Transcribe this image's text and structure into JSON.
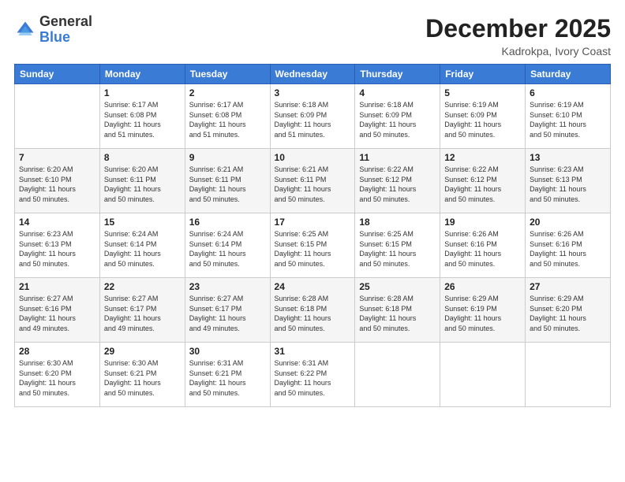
{
  "header": {
    "logo": {
      "general": "General",
      "blue": "Blue"
    },
    "month": "December 2025",
    "location": "Kadrokpa, Ivory Coast"
  },
  "weekdays": [
    "Sunday",
    "Monday",
    "Tuesday",
    "Wednesday",
    "Thursday",
    "Friday",
    "Saturday"
  ],
  "weeks": [
    [
      {
        "day": "",
        "info": ""
      },
      {
        "day": "1",
        "info": "Sunrise: 6:17 AM\nSunset: 6:08 PM\nDaylight: 11 hours\nand 51 minutes."
      },
      {
        "day": "2",
        "info": "Sunrise: 6:17 AM\nSunset: 6:08 PM\nDaylight: 11 hours\nand 51 minutes."
      },
      {
        "day": "3",
        "info": "Sunrise: 6:18 AM\nSunset: 6:09 PM\nDaylight: 11 hours\nand 51 minutes."
      },
      {
        "day": "4",
        "info": "Sunrise: 6:18 AM\nSunset: 6:09 PM\nDaylight: 11 hours\nand 50 minutes."
      },
      {
        "day": "5",
        "info": "Sunrise: 6:19 AM\nSunset: 6:09 PM\nDaylight: 11 hours\nand 50 minutes."
      },
      {
        "day": "6",
        "info": "Sunrise: 6:19 AM\nSunset: 6:10 PM\nDaylight: 11 hours\nand 50 minutes."
      }
    ],
    [
      {
        "day": "7",
        "info": "Sunrise: 6:20 AM\nSunset: 6:10 PM\nDaylight: 11 hours\nand 50 minutes."
      },
      {
        "day": "8",
        "info": "Sunrise: 6:20 AM\nSunset: 6:11 PM\nDaylight: 11 hours\nand 50 minutes."
      },
      {
        "day": "9",
        "info": "Sunrise: 6:21 AM\nSunset: 6:11 PM\nDaylight: 11 hours\nand 50 minutes."
      },
      {
        "day": "10",
        "info": "Sunrise: 6:21 AM\nSunset: 6:11 PM\nDaylight: 11 hours\nand 50 minutes."
      },
      {
        "day": "11",
        "info": "Sunrise: 6:22 AM\nSunset: 6:12 PM\nDaylight: 11 hours\nand 50 minutes."
      },
      {
        "day": "12",
        "info": "Sunrise: 6:22 AM\nSunset: 6:12 PM\nDaylight: 11 hours\nand 50 minutes."
      },
      {
        "day": "13",
        "info": "Sunrise: 6:23 AM\nSunset: 6:13 PM\nDaylight: 11 hours\nand 50 minutes."
      }
    ],
    [
      {
        "day": "14",
        "info": "Sunrise: 6:23 AM\nSunset: 6:13 PM\nDaylight: 11 hours\nand 50 minutes."
      },
      {
        "day": "15",
        "info": "Sunrise: 6:24 AM\nSunset: 6:14 PM\nDaylight: 11 hours\nand 50 minutes."
      },
      {
        "day": "16",
        "info": "Sunrise: 6:24 AM\nSunset: 6:14 PM\nDaylight: 11 hours\nand 50 minutes."
      },
      {
        "day": "17",
        "info": "Sunrise: 6:25 AM\nSunset: 6:15 PM\nDaylight: 11 hours\nand 50 minutes."
      },
      {
        "day": "18",
        "info": "Sunrise: 6:25 AM\nSunset: 6:15 PM\nDaylight: 11 hours\nand 50 minutes."
      },
      {
        "day": "19",
        "info": "Sunrise: 6:26 AM\nSunset: 6:16 PM\nDaylight: 11 hours\nand 50 minutes."
      },
      {
        "day": "20",
        "info": "Sunrise: 6:26 AM\nSunset: 6:16 PM\nDaylight: 11 hours\nand 50 minutes."
      }
    ],
    [
      {
        "day": "21",
        "info": "Sunrise: 6:27 AM\nSunset: 6:16 PM\nDaylight: 11 hours\nand 49 minutes."
      },
      {
        "day": "22",
        "info": "Sunrise: 6:27 AM\nSunset: 6:17 PM\nDaylight: 11 hours\nand 49 minutes."
      },
      {
        "day": "23",
        "info": "Sunrise: 6:27 AM\nSunset: 6:17 PM\nDaylight: 11 hours\nand 49 minutes."
      },
      {
        "day": "24",
        "info": "Sunrise: 6:28 AM\nSunset: 6:18 PM\nDaylight: 11 hours\nand 50 minutes."
      },
      {
        "day": "25",
        "info": "Sunrise: 6:28 AM\nSunset: 6:18 PM\nDaylight: 11 hours\nand 50 minutes."
      },
      {
        "day": "26",
        "info": "Sunrise: 6:29 AM\nSunset: 6:19 PM\nDaylight: 11 hours\nand 50 minutes."
      },
      {
        "day": "27",
        "info": "Sunrise: 6:29 AM\nSunset: 6:20 PM\nDaylight: 11 hours\nand 50 minutes."
      }
    ],
    [
      {
        "day": "28",
        "info": "Sunrise: 6:30 AM\nSunset: 6:20 PM\nDaylight: 11 hours\nand 50 minutes."
      },
      {
        "day": "29",
        "info": "Sunrise: 6:30 AM\nSunset: 6:21 PM\nDaylight: 11 hours\nand 50 minutes."
      },
      {
        "day": "30",
        "info": "Sunrise: 6:31 AM\nSunset: 6:21 PM\nDaylight: 11 hours\nand 50 minutes."
      },
      {
        "day": "31",
        "info": "Sunrise: 6:31 AM\nSunset: 6:22 PM\nDaylight: 11 hours\nand 50 minutes."
      },
      {
        "day": "",
        "info": ""
      },
      {
        "day": "",
        "info": ""
      },
      {
        "day": "",
        "info": ""
      }
    ]
  ]
}
